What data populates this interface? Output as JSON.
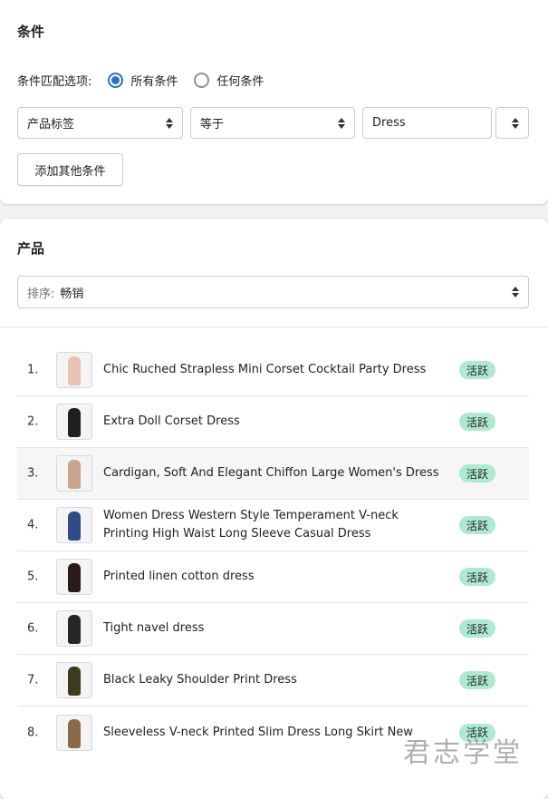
{
  "conditions": {
    "title": "条件",
    "match_label": "条件匹配选项:",
    "option_all": "所有条件",
    "option_any": "任何条件",
    "selected_option": "所有条件",
    "field_select": "产品标签",
    "operator_select": "等于",
    "value_input": "Dress",
    "add_button": "添加其他条件"
  },
  "products": {
    "title": "产品",
    "sort_label": "排序:",
    "sort_value": "畅销",
    "items": [
      {
        "num": "1.",
        "name": "Chic Ruched Strapless Mini Corset Cocktail Party Dress",
        "status": "活跃",
        "thumb": "pink-dress-thumbnail",
        "color": "#e8c2b5"
      },
      {
        "num": "2.",
        "name": "Extra Doll Corset Dress",
        "status": "活跃",
        "thumb": "black-dress-thumbnail",
        "color": "#1f1f1f"
      },
      {
        "num": "3.",
        "name": "Cardigan, Soft And Elegant Chiffon Large Women's Dress",
        "status": "活跃",
        "thumb": "beige-cardigan-thumbnail",
        "color": "#c9a48f"
      },
      {
        "num": "4.",
        "name": "Women Dress Western Style Temperament V-neck Printing High Waist Long Sleeve Casual Dress",
        "status": "活跃",
        "thumb": "blue-print-dress-thumbnail",
        "color": "#2f4c86"
      },
      {
        "num": "5.",
        "name": "Printed linen cotton dress",
        "status": "活跃",
        "thumb": "black-red-dress-thumbnail",
        "color": "#2a1a1a"
      },
      {
        "num": "6.",
        "name": "Tight navel dress",
        "status": "活跃",
        "thumb": "black-tight-dress-thumbnail",
        "color": "#262626"
      },
      {
        "num": "7.",
        "name": "Black Leaky Shoulder Print Dress",
        "status": "活跃",
        "thumb": "floral-dress-thumbnail",
        "color": "#3d3a1e"
      },
      {
        "num": "8.",
        "name": "Sleeveless V-neck Printed Slim Dress Long Skirt New",
        "status": "活跃",
        "thumb": "leopard-dress-thumbnail",
        "color": "#8a6a4a"
      }
    ]
  },
  "watermark": "君志学堂",
  "colors": {
    "accent": "#2c6ecb",
    "badge_bg": "#aee9d1"
  }
}
